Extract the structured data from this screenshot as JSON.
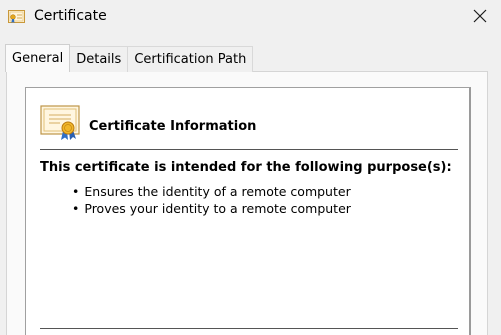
{
  "window": {
    "title": "Certificate",
    "title_icon": "certificate-icon",
    "close_icon": "close-icon"
  },
  "tabs": [
    {
      "label": "General",
      "active": true
    },
    {
      "label": "Details",
      "active": false
    },
    {
      "label": "Certification Path",
      "active": false
    }
  ],
  "general": {
    "info_icon": "certificate-ribbon-icon",
    "heading": "Certificate Information",
    "purpose_heading": "This certificate is intended for the following purpose(s):",
    "purposes": [
      "Ensures the identity of a remote computer",
      "Proves your identity to a remote computer"
    ]
  },
  "colors": {
    "background": "#f0f0f0",
    "panel": "#fafafa",
    "info_box": "#ffffff",
    "ribbon_gold": "#e3a81f",
    "ribbon_blue": "#2f6fc7"
  }
}
